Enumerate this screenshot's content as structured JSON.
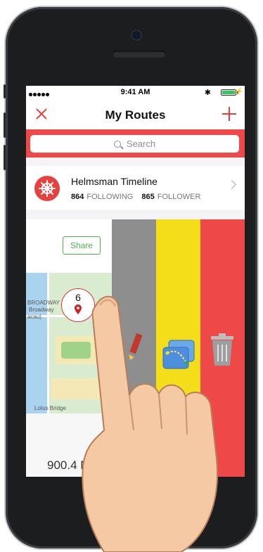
{
  "status_bar": {
    "time": "9:41 AM",
    "carrier_dots": 5
  },
  "nav": {
    "title": "My Routes",
    "close_icon": "close-icon",
    "add_icon": "plus-icon",
    "accent": "#ef3d3d"
  },
  "search": {
    "placeholder": "Search"
  },
  "profile": {
    "name": "Helmsman Timeline",
    "following_count": "864",
    "following_label": "FOLLOWING",
    "follower_count": "865",
    "follower_label": "FOLLOWER"
  },
  "route_card": {
    "share_label": "Share",
    "point_count": "6",
    "distance": "900.4 M",
    "map_labels": [
      "BROADWAY",
      "Broadway",
      "acau)",
      "Lotus Bridge"
    ]
  },
  "swipe_actions": [
    {
      "name": "edit",
      "color": "#8e8e8e",
      "icon": "pencil-icon"
    },
    {
      "name": "route",
      "color": "#f4de19",
      "icon": "route-icon"
    },
    {
      "name": "delete",
      "color": "#ef4848",
      "icon": "trash-icon"
    }
  ]
}
